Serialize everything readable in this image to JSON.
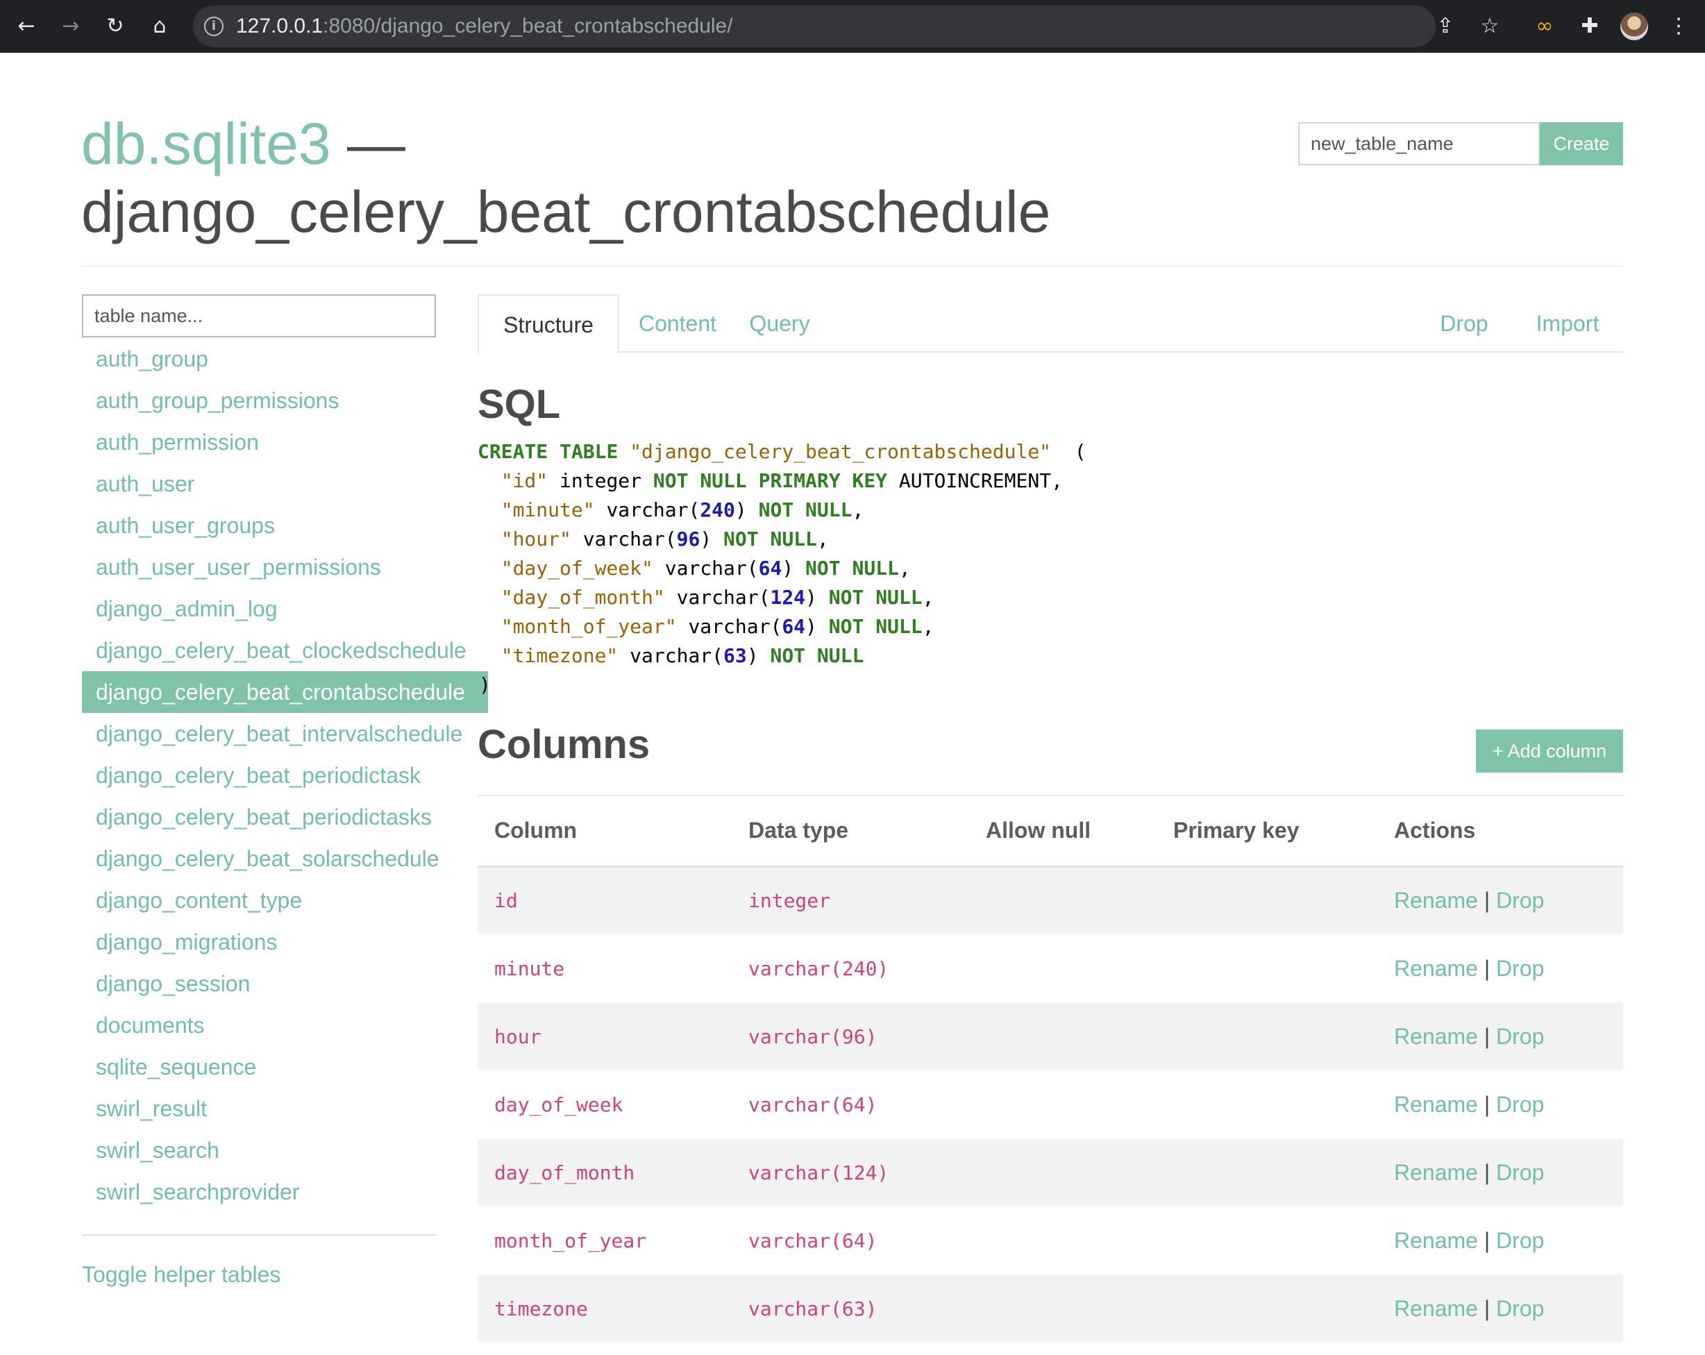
{
  "browser": {
    "url_host": "127.0.0.1",
    "url_rest": ":8080/django_celery_beat_crontabschedule/"
  },
  "header": {
    "db_name": "db.sqlite3",
    "separator": " —",
    "table_name": "django_celery_beat_crontabschedule",
    "new_table_placeholder": "new_table_name",
    "create_label": "Create"
  },
  "sidebar": {
    "search_placeholder": "table name...",
    "tables": [
      "auth_group",
      "auth_group_permissions",
      "auth_permission",
      "auth_user",
      "auth_user_groups",
      "auth_user_user_permissions",
      "django_admin_log",
      "django_celery_beat_clockedschedule",
      "django_celery_beat_crontabschedule",
      "django_celery_beat_intervalschedule",
      "django_celery_beat_periodictask",
      "django_celery_beat_periodictasks",
      "django_celery_beat_solarschedule",
      "django_content_type",
      "django_migrations",
      "django_session",
      "documents",
      "sqlite_sequence",
      "swirl_result",
      "swirl_search",
      "swirl_searchprovider"
    ],
    "active_table": "django_celery_beat_crontabschedule",
    "toggle_label": "Toggle helper tables"
  },
  "tabs": {
    "structure": "Structure",
    "content": "Content",
    "query": "Query",
    "drop": "Drop",
    "import": "Import"
  },
  "sql": {
    "heading": "SQL",
    "create": "CREATE",
    "table": "TABLE",
    "table_quoted": "\"django_celery_beat_crontabschedule\"",
    "open_paren": "  (",
    "close_paren": ")",
    "lines": [
      {
        "name": "\"id\"",
        "type": "integer",
        "num": "",
        "constraint": "NOT NULL PRIMARY KEY",
        "extra": "AUTOINCREMENT",
        "comma": ","
      },
      {
        "name": "\"minute\"",
        "type": "varchar",
        "num": "240",
        "constraint": "NOT NULL",
        "extra": "",
        "comma": ","
      },
      {
        "name": "\"hour\"",
        "type": "varchar",
        "num": "96",
        "constraint": "NOT NULL",
        "extra": "",
        "comma": ","
      },
      {
        "name": "\"day_of_week\"",
        "type": "varchar",
        "num": "64",
        "constraint": "NOT NULL",
        "extra": "",
        "comma": ","
      },
      {
        "name": "\"day_of_month\"",
        "type": "varchar",
        "num": "124",
        "constraint": "NOT NULL",
        "extra": "",
        "comma": ","
      },
      {
        "name": "\"month_of_year\"",
        "type": "varchar",
        "num": "64",
        "constraint": "NOT NULL",
        "extra": "",
        "comma": ","
      },
      {
        "name": "\"timezone\"",
        "type": "varchar",
        "num": "63",
        "constraint": "NOT NULL",
        "extra": "",
        "comma": ""
      }
    ]
  },
  "columns_section": {
    "heading": "Columns",
    "add_label": "+ Add column",
    "headers": [
      "Column",
      "Data type",
      "Allow null",
      "Primary key",
      "Actions"
    ],
    "rows": [
      {
        "column": "id",
        "type": "integer"
      },
      {
        "column": "minute",
        "type": "varchar(240)"
      },
      {
        "column": "hour",
        "type": "varchar(96)"
      },
      {
        "column": "day_of_week",
        "type": "varchar(64)"
      },
      {
        "column": "day_of_month",
        "type": "varchar(124)"
      },
      {
        "column": "month_of_year",
        "type": "varchar(64)"
      },
      {
        "column": "timezone",
        "type": "varchar(63)"
      }
    ],
    "rename_label": "Rename",
    "sep": " | ",
    "drop_label": "Drop"
  },
  "colors": {
    "accent": "#7fc3a8",
    "link": "#6fc1a2",
    "sql_keyword": "#2f7f21",
    "sql_string": "#9a6206",
    "sql_number": "#1b17b8",
    "code_text": "#d0427a"
  },
  "icons": [
    "back-arrow-icon",
    "forward-arrow-icon",
    "reload-icon",
    "home-icon",
    "info-icon",
    "share-icon",
    "star-icon",
    "extension-link-icon",
    "puzzle-icon",
    "avatar",
    "kebab-menu-icon"
  ]
}
